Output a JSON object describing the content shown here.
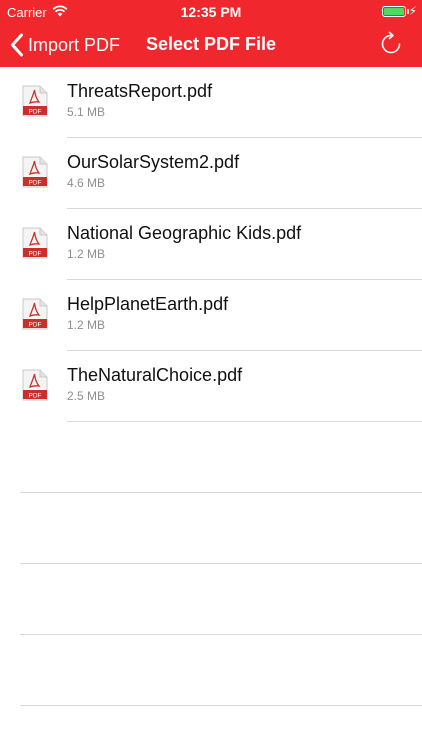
{
  "status_bar": {
    "carrier": "Carrier",
    "time": "12:35 PM",
    "battery_percent": 100,
    "battery_color": "#4cd964"
  },
  "nav": {
    "back_label": "Import PDF",
    "title": "Select PDF File",
    "back_icon": "chevron-left-icon",
    "refresh_icon": "refresh-icon",
    "bar_color": "#f0282d"
  },
  "files": [
    {
      "name": "ThreatsReport.pdf",
      "size": "5.1 MB"
    },
    {
      "name": "OurSolarSystem2.pdf",
      "size": "4.6 MB"
    },
    {
      "name": "National Geographic Kids.pdf",
      "size": "1.2 MB"
    },
    {
      "name": "HelpPlanetEarth.pdf",
      "size": "1.2 MB"
    },
    {
      "name": "TheNaturalChoice.pdf",
      "size": "2.5 MB"
    }
  ],
  "file_icon": {
    "name": "pdf-file-icon",
    "badge": "PDF"
  }
}
